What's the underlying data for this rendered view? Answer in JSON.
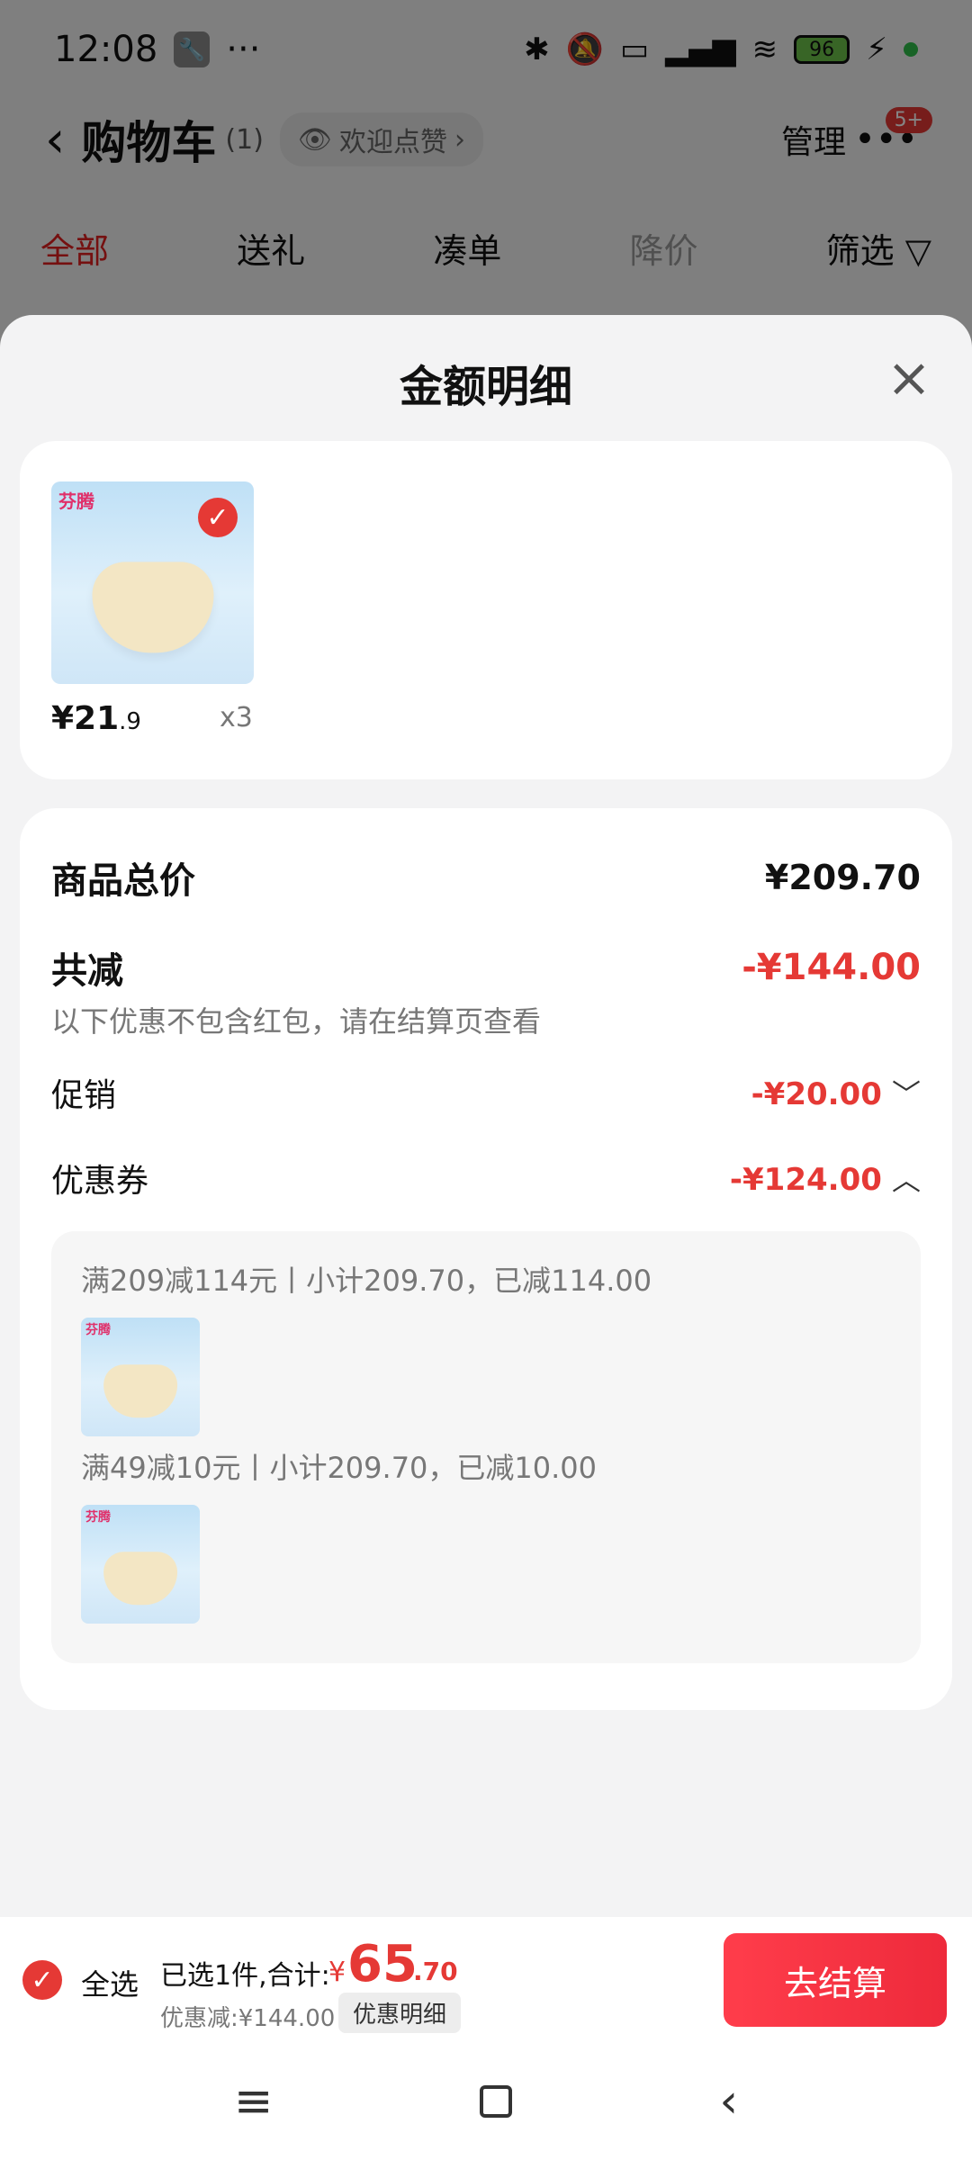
{
  "status_bar": {
    "time": "12:08",
    "more_dots": "···",
    "battery": "96"
  },
  "header": {
    "title": "购物车",
    "count": "(1)",
    "welcome": "欢迎点赞",
    "manage": "管理",
    "badge": "5+"
  },
  "tabs": [
    {
      "label": "全部"
    },
    {
      "label": "送礼"
    },
    {
      "label": "凑单"
    },
    {
      "label": "降价"
    },
    {
      "label": "筛选"
    }
  ],
  "sheet": {
    "title": "金额明细",
    "product": {
      "logo": "芬腾",
      "price_int": "¥21",
      "price_dec": ".9",
      "qty": "x3"
    },
    "summary": {
      "total_label": "商品总价",
      "total_value": "¥209.70",
      "reduce_label": "共减",
      "reduce_value": "-¥144.00",
      "note": "以下优惠不包含红包，请在结算页查看",
      "promo_label": "促销",
      "promo_value": "-¥20.00",
      "coupon_label": "优惠券",
      "coupon_value": "-¥124.00",
      "coupons": [
        {
          "text": "满209减114元丨小计209.70，已减114.00"
        },
        {
          "text": "满49减10元丨小计209.70，已减10.00"
        }
      ]
    }
  },
  "checkout": {
    "select_all": "全选",
    "selected_text": "已选1件,合计:",
    "currency": "¥",
    "total_int": "65",
    "total_dec": ".70",
    "discount_text": "优惠减:¥144.00",
    "discount_detail": "优惠明细",
    "button": "去结算"
  },
  "colors": {
    "accent": "#e53935",
    "sheet_bg": "#f3f3f4"
  }
}
